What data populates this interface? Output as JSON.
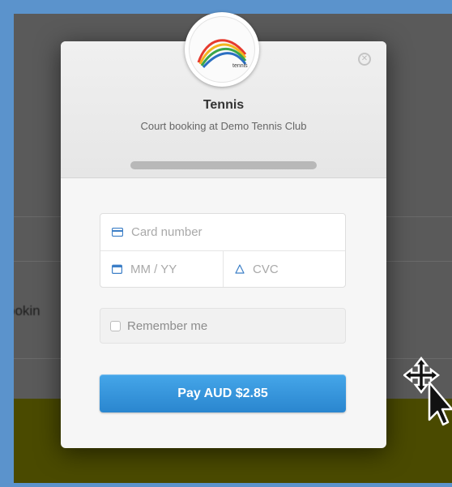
{
  "merchant": {
    "title": "Tennis",
    "description": "Court booking at Demo Tennis Club",
    "logo_text": "tennis"
  },
  "background": {
    "partial_text": "ookin"
  },
  "form": {
    "card_number_placeholder": "Card number",
    "expiry_placeholder": "MM / YY",
    "cvc_placeholder": "CVC",
    "remember_label": "Remember me",
    "remember_checked": false,
    "pay_label": "Pay AUD $2.85"
  },
  "icons": {
    "close": "close-icon",
    "card": "credit-card-icon",
    "calendar": "calendar-icon",
    "lock": "lock-icon",
    "cursor": "move-cursor-icon"
  },
  "colors": {
    "pay_button": "#2a86cf",
    "frame_border": "#5b93cc",
    "backdrop": "#5a5a5a",
    "olive_band": "#4a4a00"
  }
}
